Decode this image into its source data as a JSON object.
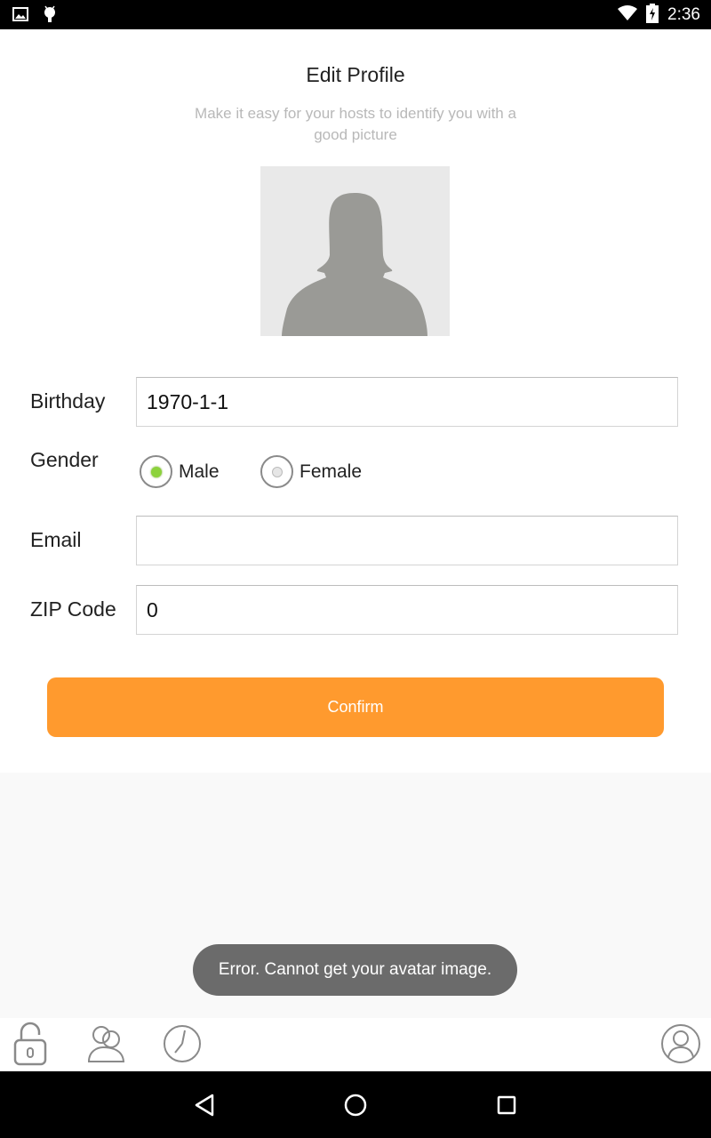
{
  "status_bar": {
    "time": "2:36",
    "icons": [
      "image-icon",
      "android-icon",
      "wifi-icon",
      "battery-charging-icon"
    ]
  },
  "header": {
    "title": "Edit Profile",
    "subtitle": "Make it easy for your hosts to identify you with a good picture"
  },
  "avatar": {
    "icon": "female-silhouette-avatar"
  },
  "form": {
    "birthday": {
      "label": "Birthday",
      "value": "1970-1-1"
    },
    "gender": {
      "label": "Gender",
      "options": [
        {
          "label": "Male",
          "selected": true
        },
        {
          "label": "Female",
          "selected": false
        }
      ]
    },
    "email": {
      "label": "Email",
      "value": ""
    },
    "zip": {
      "label": "ZIP Code",
      "value": "0"
    }
  },
  "confirm_label": "Confirm",
  "toast": "Error. Cannot get your avatar image.",
  "tab_bar": {
    "icons": [
      "lock-icon",
      "people-icon",
      "clock-icon",
      "profile-icon"
    ]
  },
  "nav_bar": {
    "icons": [
      "back-icon",
      "home-icon",
      "recents-icon"
    ]
  },
  "colors": {
    "accent": "#ff9a2e",
    "radio_selected": "#8cd23c",
    "toast_bg": "#6b6b6b",
    "icon_gray": "#8a8a8a"
  }
}
